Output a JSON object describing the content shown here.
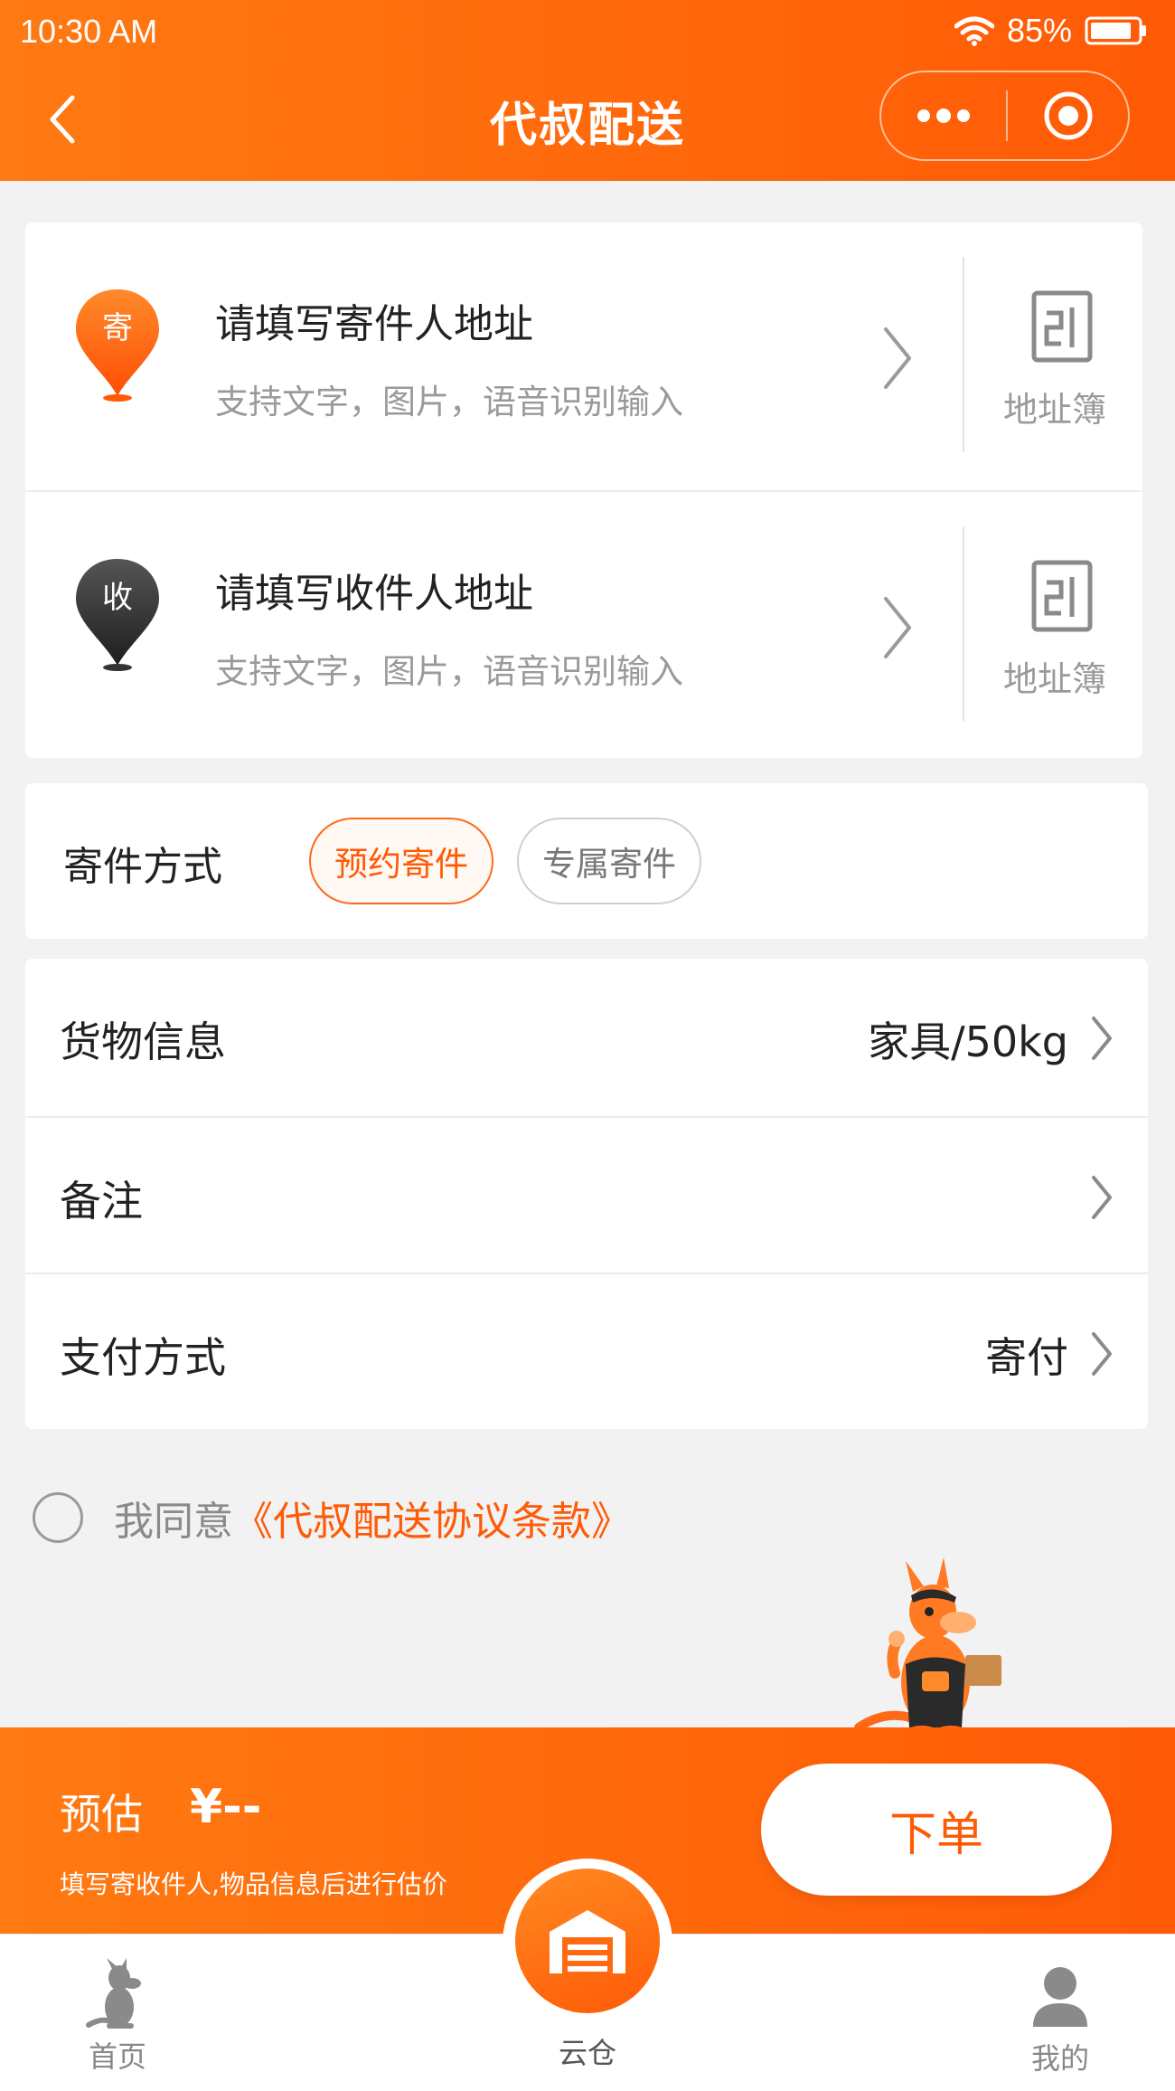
{
  "status_bar": {
    "time": "10:30 AM",
    "battery": "85%"
  },
  "header": {
    "title": "代叔配送"
  },
  "sender": {
    "pin_label": "寄",
    "title": "请填写寄件人地址",
    "subtitle": "支持文字，图片，语音识别输入",
    "book_label": "地址簿"
  },
  "receiver": {
    "pin_label": "收",
    "title": "请填写收件人地址",
    "subtitle": "支持文字，图片，语音识别输入",
    "book_label": "地址簿"
  },
  "send_method": {
    "label": "寄件方式",
    "options": [
      "预约寄件",
      "专属寄件"
    ],
    "selected": "预约寄件"
  },
  "goods": {
    "label": "货物信息",
    "value": "家具/50kg"
  },
  "remark": {
    "label": "备注",
    "value": ""
  },
  "payment": {
    "label": "支付方式",
    "value": "寄付"
  },
  "agreement": {
    "prefix": "我同意",
    "link": "《代叔配送协议条款》",
    "checked": false
  },
  "estimate": {
    "label": "预估",
    "price": "¥--",
    "hint": "填写寄收件人,物品信息后进行估价"
  },
  "order_button": "下单",
  "tabbar": {
    "home": "首页",
    "cloud": "云仓",
    "mine": "我的"
  },
  "colors": {
    "brand_orange": "#ff5a06",
    "brand_orange_light": "#ff7a12",
    "receiver_pin": "#333333",
    "muted_text": "#9a9a9a"
  },
  "icons": [
    "back-icon",
    "more-dots-icon",
    "target-icon",
    "sender-pin-icon",
    "receiver-pin-icon",
    "chevron-right-icon",
    "address-book-icon",
    "kangaroo-mascot",
    "kangaroo-home-icon",
    "warehouse-icon",
    "user-icon"
  ]
}
